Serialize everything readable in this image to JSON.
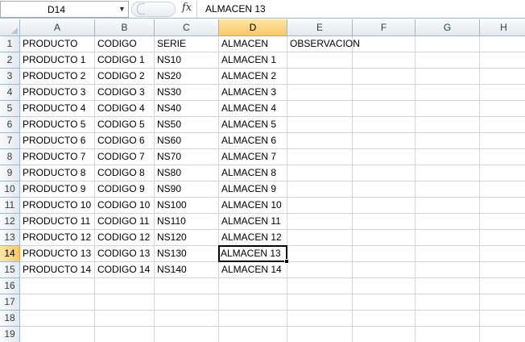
{
  "formula_bar": {
    "name_box": "D14",
    "fx_label": "fx",
    "content": "ALMACEN 13"
  },
  "selection": {
    "column": "D",
    "row": "14"
  },
  "columns": [
    "A",
    "B",
    "C",
    "D",
    "E",
    "F",
    "G",
    "H"
  ],
  "rows": [
    "1",
    "2",
    "3",
    "4",
    "5",
    "6",
    "7",
    "8",
    "9",
    "10",
    "11",
    "12",
    "13",
    "14",
    "15",
    "16",
    "17",
    "18",
    "19"
  ],
  "cells": [
    [
      "PRODUCTO",
      "CODIGO",
      "SERIE",
      "ALMACEN",
      "OBSERVACION"
    ],
    [
      "PRODUCTO 1",
      "CODIGO 1",
      "NS10",
      "ALMACEN 1",
      ""
    ],
    [
      "PRODUCTO 2",
      "CODIGO 2",
      "NS20",
      "ALMACEN 2",
      ""
    ],
    [
      "PRODUCTO 3",
      "CODIGO 3",
      "NS30",
      "ALMACEN 3",
      ""
    ],
    [
      "PRODUCTO 4",
      "CODIGO 4",
      "NS40",
      "ALMACEN 4",
      ""
    ],
    [
      "PRODUCTO 5",
      "CODIGO 5",
      "NS50",
      "ALMACEN 5",
      ""
    ],
    [
      "PRODUCTO 6",
      "CODIGO 6",
      "NS60",
      "ALMACEN 6",
      ""
    ],
    [
      "PRODUCTO 7",
      "CODIGO 7",
      "NS70",
      "ALMACEN 7",
      ""
    ],
    [
      "PRODUCTO 8",
      "CODIGO 8",
      "NS80",
      "ALMACEN 8",
      ""
    ],
    [
      "PRODUCTO 9",
      "CODIGO 9",
      "NS90",
      "ALMACEN 9",
      ""
    ],
    [
      "PRODUCTO 10",
      "CODIGO 10",
      "NS100",
      "ALMACEN 10",
      ""
    ],
    [
      "PRODUCTO 11",
      "CODIGO 11",
      "NS110",
      "ALMACEN 11",
      ""
    ],
    [
      "PRODUCTO 12",
      "CODIGO 12",
      "NS120",
      "ALMACEN 12",
      ""
    ],
    [
      "PRODUCTO 13",
      "CODIGO 13",
      "NS130",
      "ALMACEN 13",
      ""
    ],
    [
      "PRODUCTO 14",
      "CODIGO 14",
      "NS140",
      "ALMACEN 14",
      ""
    ]
  ]
}
